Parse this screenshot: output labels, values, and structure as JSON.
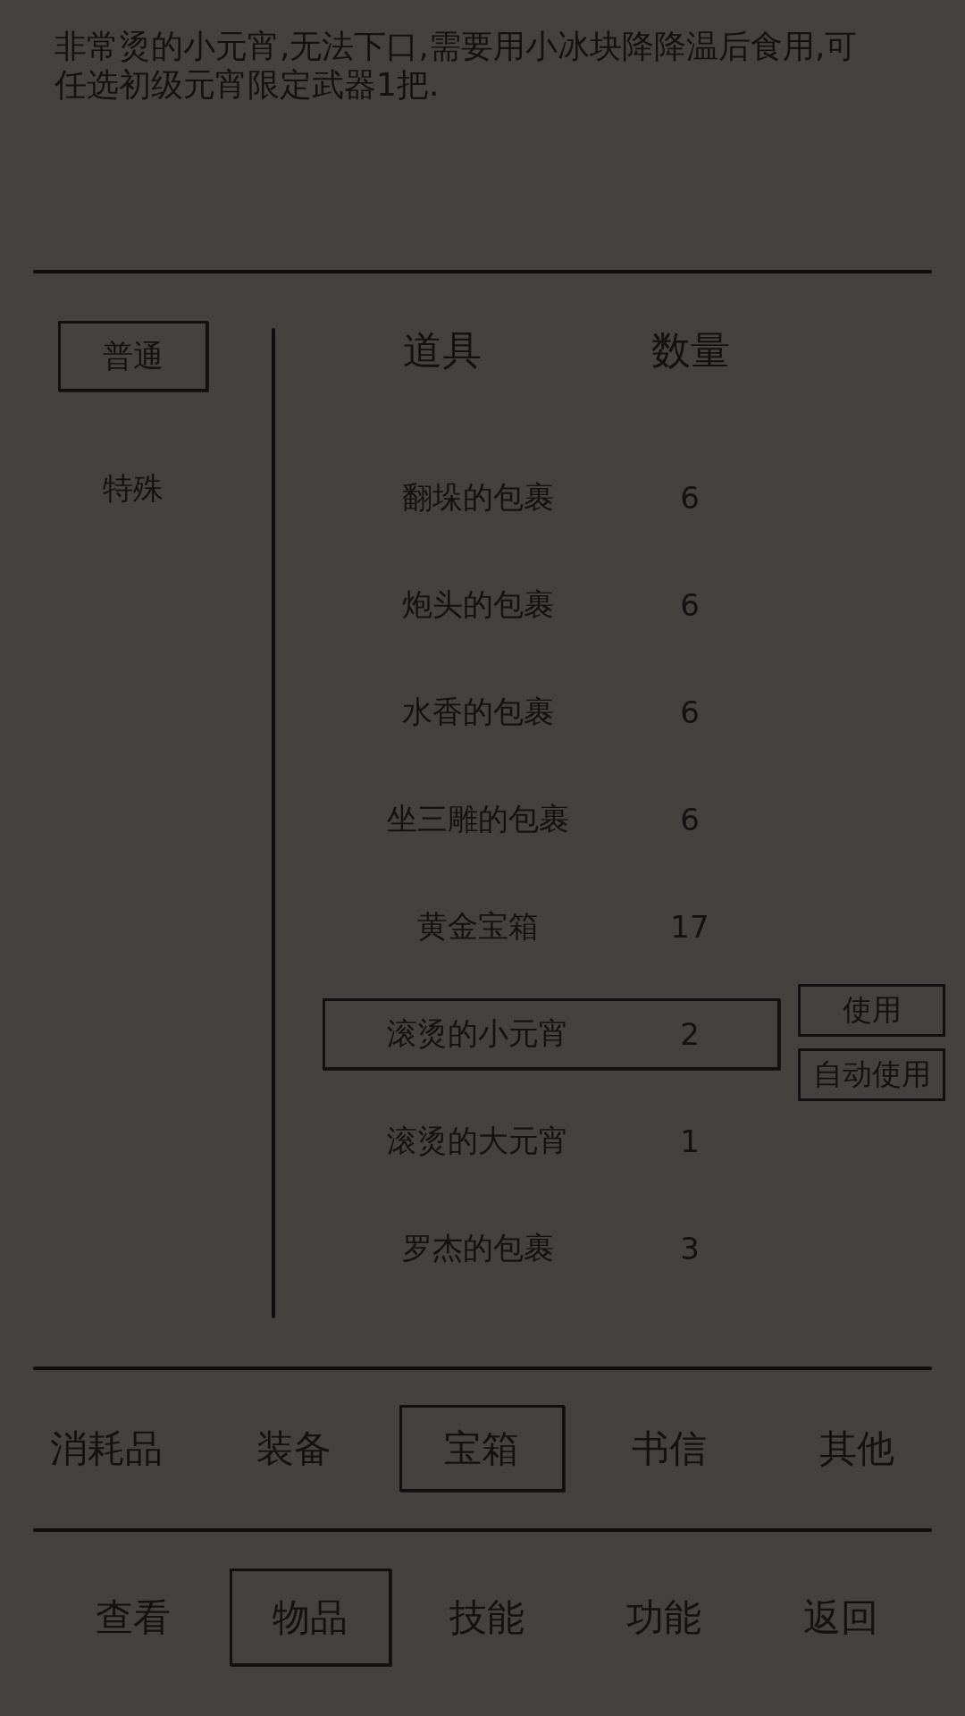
{
  "description": "非常烫的小元宵,无法下口,需要用小冰块降降温后食用,可任选初级元宵限定武器1把.",
  "filter_tabs": [
    {
      "label": "普通",
      "selected": true
    },
    {
      "label": "特殊",
      "selected": false
    }
  ],
  "table": {
    "columns": [
      "道具",
      "数量"
    ],
    "rows": [
      {
        "name": "翻垛的包裹",
        "count": "6",
        "selected": false
      },
      {
        "name": "炮头的包裹",
        "count": "6",
        "selected": false
      },
      {
        "name": "水香的包裹",
        "count": "6",
        "selected": false
      },
      {
        "name": "坐三雕的包裹",
        "count": "6",
        "selected": false
      },
      {
        "name": "黄金宝箱",
        "count": "17",
        "selected": false
      },
      {
        "name": "滚烫的小元宵",
        "count": "2",
        "selected": true
      },
      {
        "name": "滚烫的大元宵",
        "count": "1",
        "selected": false
      },
      {
        "name": "罗杰的包裹",
        "count": "3",
        "selected": false
      }
    ],
    "actions": [
      "使用",
      "自动使用"
    ]
  },
  "category_tabs": [
    {
      "label": "消耗品",
      "selected": false
    },
    {
      "label": "装备",
      "selected": false
    },
    {
      "label": "宝箱",
      "selected": true
    },
    {
      "label": "书信",
      "selected": false
    },
    {
      "label": "其他",
      "selected": false
    }
  ],
  "nav_tabs": [
    {
      "label": "查看",
      "selected": false
    },
    {
      "label": "物品",
      "selected": true
    },
    {
      "label": "技能",
      "selected": false
    },
    {
      "label": "功能",
      "selected": false
    },
    {
      "label": "返回",
      "selected": false
    }
  ]
}
